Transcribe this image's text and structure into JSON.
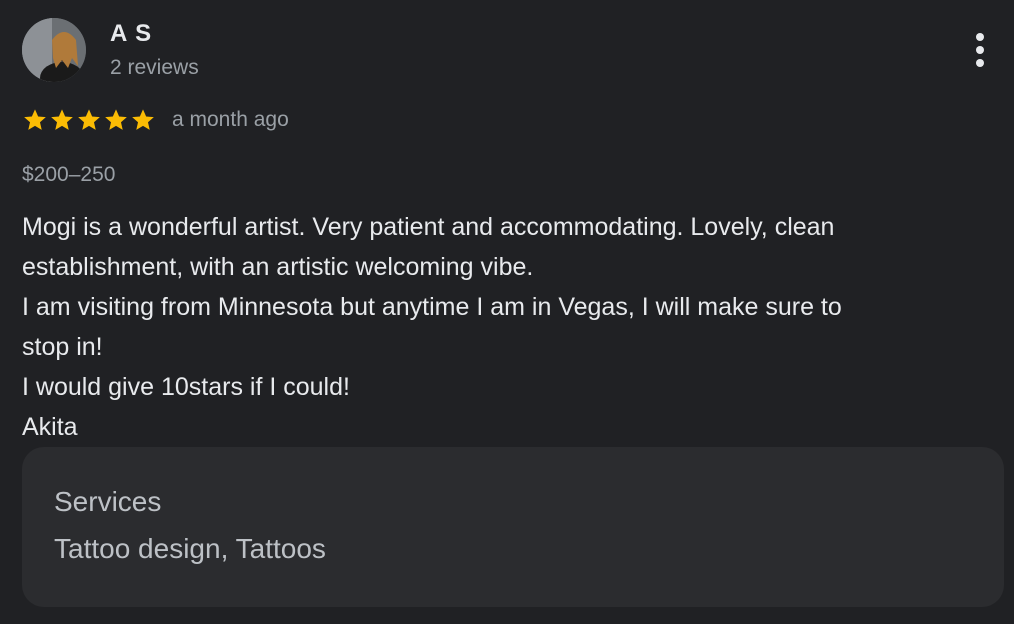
{
  "reviewer": {
    "name": "A S",
    "review_count": "2 reviews",
    "avatar": "profile-photo"
  },
  "menu": {
    "icon": "more-vert-icon"
  },
  "rating": {
    "stars": 5,
    "max_stars": 5,
    "star_color": "#fbbc04",
    "date": "a month ago"
  },
  "price": "$200–250",
  "review_lines": [
    "Mogi is a wonderful artist. Very patient and accommodating. Lovely, clean",
    "establishment, with an artistic welcoming vibe.",
    "I am visiting from Minnesota but anytime I am in Vegas, I will make sure to",
    "stop in!",
    "I would give 10stars if I could!",
    "Akita"
  ],
  "services": {
    "title": "Services",
    "value": "Tattoo design, Tattoos"
  },
  "colors": {
    "background": "#202124",
    "panel": "#2b2c2f",
    "text_primary": "#e8eaed",
    "text_secondary": "#9aa0a6"
  }
}
